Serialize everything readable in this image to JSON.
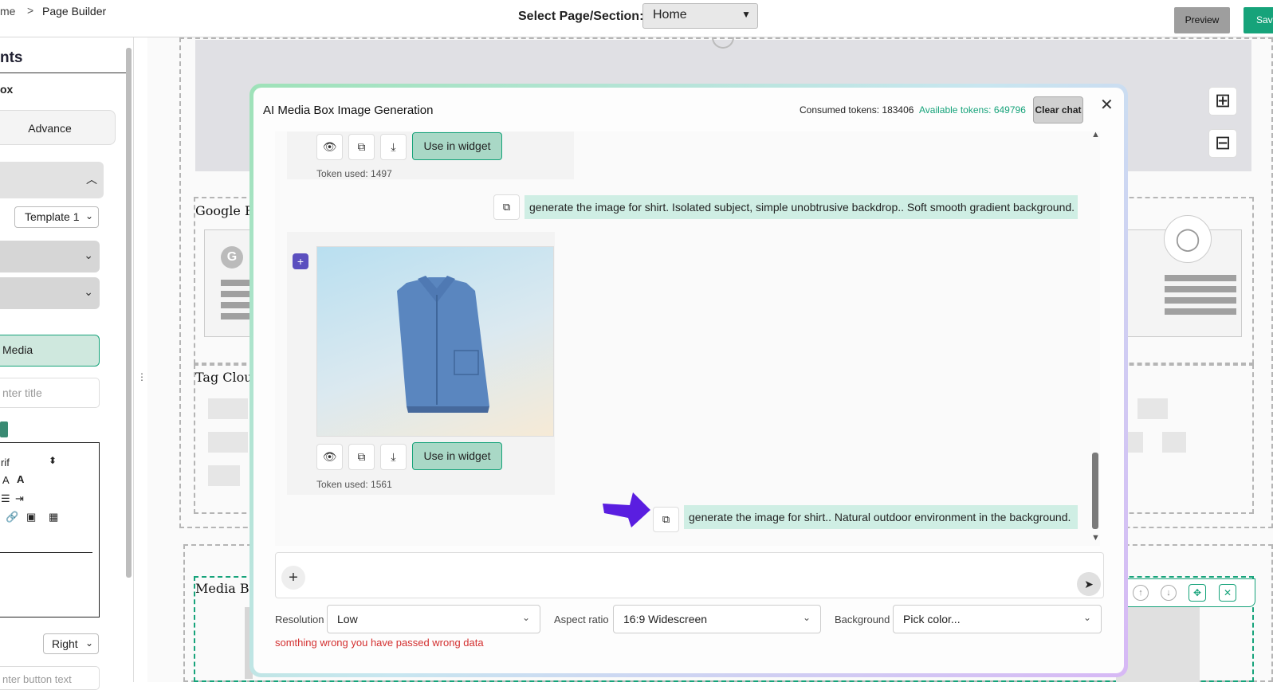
{
  "topbar": {
    "breadcrumb_home": "me",
    "breadcrumb_sep": ">",
    "breadcrumb_page": "Page Builder",
    "select_label": "Select Page/Section:",
    "select_value": "Home",
    "preview_label": "Preview",
    "save_label": "Save"
  },
  "left_panel": {
    "title": "nts",
    "subtitle": "ox",
    "advance_label": "Advance",
    "template_value": "Template 1",
    "media_label": "Media",
    "title_placeholder": "nter title",
    "font_value": "rif",
    "align_value": "Right",
    "button_text_placeholder": "nter button text"
  },
  "canvas": {
    "section_google": "Google Re",
    "section_tag_cloud": "Tag Cloud",
    "section_media_box": "Media Bo",
    "google_badge": "G"
  },
  "modal": {
    "title": "AI Media Box Image Generation",
    "consumed_tokens": "Consumed tokens: 183406",
    "available_tokens": "Available tokens: 649796",
    "clear_chat_label": "Clear chat",
    "messages": [
      {
        "role": "ai",
        "use_in_widget": "Use in widget",
        "token_used": "Token used: 1497"
      },
      {
        "role": "user",
        "text": "generate the image for shirt. Isolated subject, simple unobtrusive backdrop.. Soft smooth gradient background."
      },
      {
        "role": "ai",
        "image": "blue-shirt",
        "use_in_widget": "Use in widget",
        "token_used": "Token used: 1561"
      },
      {
        "role": "user",
        "text": "generate the image for shirt.. Natural outdoor environment in the background."
      }
    ],
    "resolution_label": "Resolution",
    "resolution_value": "Low",
    "aspect_label": "Aspect ratio",
    "aspect_value": "16:9 Widescreen",
    "background_label": "Background",
    "background_value": "Pick color...",
    "error_text": "somthing wrong you have passed wrong data"
  },
  "colors": {
    "accent_green": "#16a37a",
    "error_red": "#d32f2f",
    "annotation_purple": "#5a1ee0"
  }
}
